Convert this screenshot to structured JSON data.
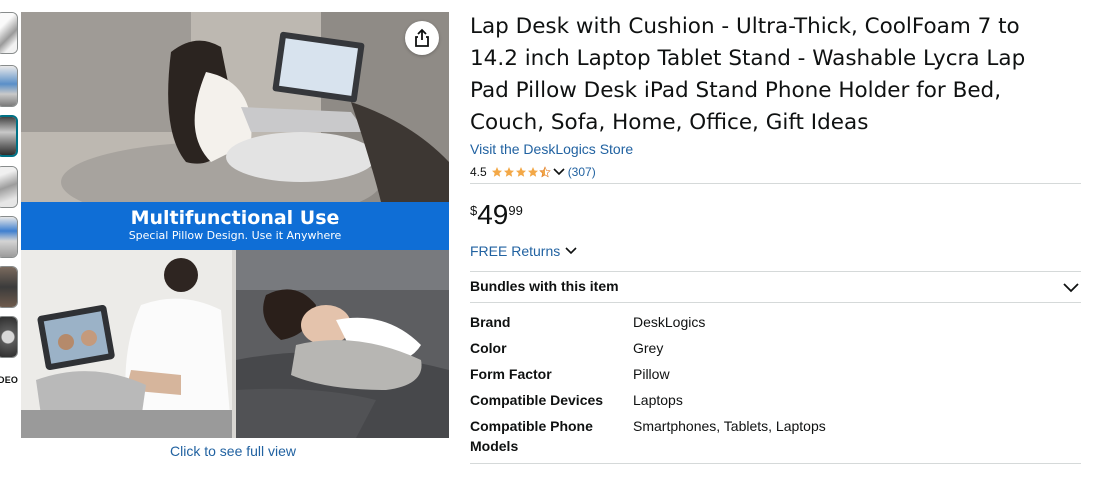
{
  "gallery": {
    "video_label": "DEO",
    "banner_title": "Multifunctional Use",
    "banner_subtitle": "Special Pillow Design. Use it Anywhere",
    "full_view_link": "Click to see full view"
  },
  "product": {
    "title": "Lap Desk with Cushion - Ultra-Thick, CoolFoam 7 to 14.2 inch Laptop Tablet Stand - Washable Lycra Lap Pad Pillow Desk iPad Stand Phone Holder for Bed, Couch, Sofa, Home, Office, Gift Ideas",
    "store_link": "Visit the DeskLogics Store",
    "rating": "4.5",
    "rating_count": "(307)",
    "price_symbol": "$",
    "price_whole": "49",
    "price_fraction": "99",
    "returns_label": "FREE Returns",
    "bundles_label": "Bundles with this item"
  },
  "specs": [
    {
      "key": "Brand",
      "value": "DeskLogics"
    },
    {
      "key": "Color",
      "value": "Grey"
    },
    {
      "key": "Form Factor",
      "value": "Pillow"
    },
    {
      "key": "Compatible Devices",
      "value": "Laptops"
    },
    {
      "key_line1": "Compatible Phone",
      "key_line2": "Models",
      "value": "Smartphones, Tablets, Laptops"
    }
  ],
  "colors": {
    "link": "#2162a1",
    "star": "#f3a847",
    "banner": "#0f6ed6",
    "selected_thumb_border": "#007185"
  },
  "icons": [
    "share-icon",
    "star-icon",
    "chevron-down-icon"
  ]
}
